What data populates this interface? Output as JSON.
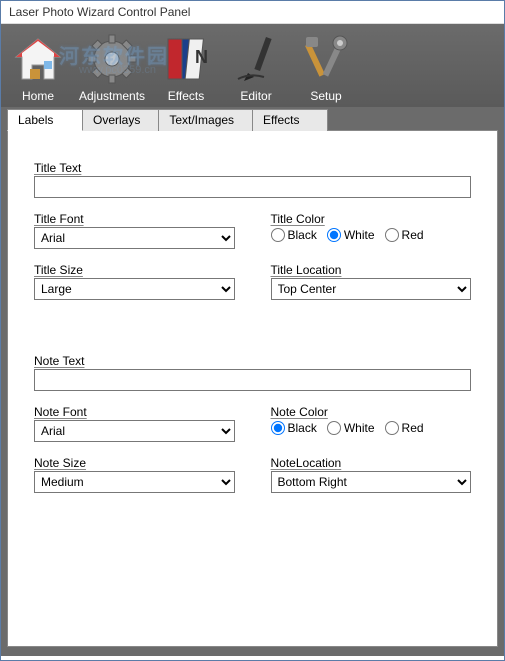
{
  "window": {
    "title": "Laser Photo Wizard Control Panel"
  },
  "watermark": {
    "main": "河东软件园",
    "url": "www.pc0359.cn"
  },
  "toolbar": [
    {
      "label": "Home"
    },
    {
      "label": "Adjustments"
    },
    {
      "label": "Effects"
    },
    {
      "label": "Editor"
    },
    {
      "label": "Setup"
    }
  ],
  "tabs": [
    {
      "label": "Labels",
      "active": true
    },
    {
      "label": "Overlays",
      "active": false
    },
    {
      "label": "Text/Images",
      "active": false
    },
    {
      "label": "Effects",
      "active": false
    }
  ],
  "form": {
    "title_text": {
      "label": "Title Text",
      "value": ""
    },
    "title_font": {
      "label": "Title Font",
      "value": "Arial"
    },
    "title_color": {
      "label": "Title Color",
      "options": [
        "Black",
        "White",
        "Red"
      ],
      "selected": "White"
    },
    "title_size": {
      "label": "Title Size",
      "value": "Large"
    },
    "title_location": {
      "label": "Title Location",
      "value": "Top Center"
    },
    "note_text": {
      "label": "Note Text",
      "value": ""
    },
    "note_font": {
      "label": "Note Font",
      "value": "Arial"
    },
    "note_color": {
      "label": "Note Color",
      "options": [
        "Black",
        "White",
        "Red"
      ],
      "selected": "Black"
    },
    "note_size": {
      "label": "Note Size",
      "value": "Medium"
    },
    "note_location": {
      "label": "NoteLocation",
      "value": "Bottom Right"
    }
  }
}
